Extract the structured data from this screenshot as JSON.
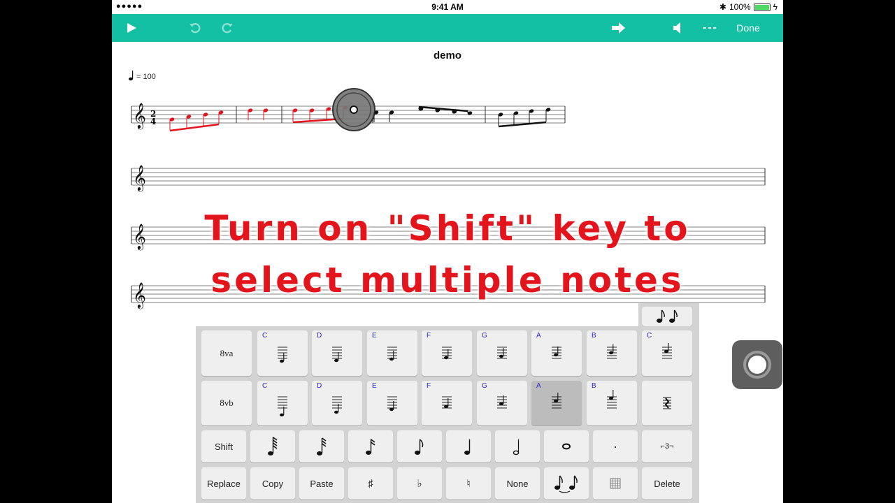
{
  "status_bar": {
    "signal": "●●●●● ",
    "time": "9:41 AM",
    "battery": "100%"
  },
  "toolbar": {
    "icons": [
      "play-icon",
      "undo-icon",
      "redo-icon",
      "forward-arrow-icon",
      "speaker-icon"
    ],
    "dash_label": "---",
    "done_label": "Done"
  },
  "score": {
    "title": "demo",
    "tempo": "= 100",
    "time_signature": [
      "2",
      "4"
    ]
  },
  "hint": {
    "line1": "Turn on \"Shift\" key to",
    "line2": "select multiple notes"
  },
  "keyboard": {
    "octave_up": "8va",
    "octave_down": "8vb",
    "upper_notes": [
      "C",
      "D",
      "E",
      "F",
      "G",
      "A",
      "B",
      "C"
    ],
    "lower_notes": [
      "C",
      "D",
      "E",
      "F",
      "G",
      "A",
      "B"
    ],
    "selected_note": "A (lower)",
    "row3": {
      "shift": "Shift",
      "dot": "·",
      "triplet": "⌐3¬"
    },
    "row4": {
      "replace": "Replace",
      "copy": "Copy",
      "paste": "Paste",
      "sharp": "♯",
      "flat": "♭",
      "natural": "♮",
      "none": "None",
      "delete": "Delete"
    }
  },
  "colors": {
    "toolbar": "#14c0a4",
    "selected_notes": "#e3141b",
    "hint": "#e3141b",
    "note_label": "#2a28c8"
  }
}
